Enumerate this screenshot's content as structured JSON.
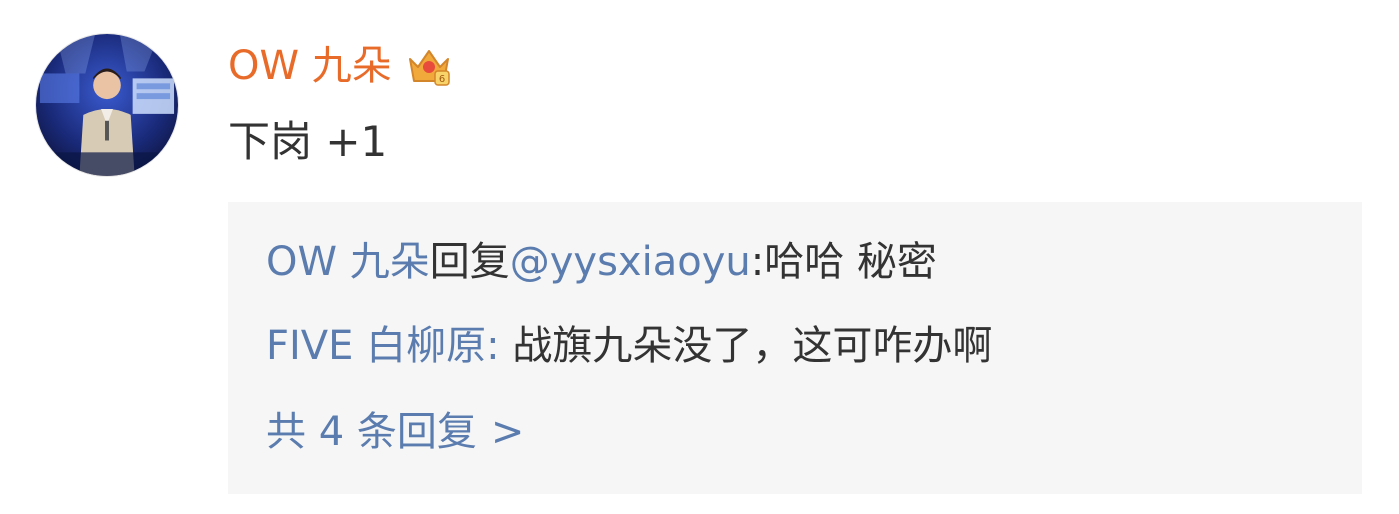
{
  "comment": {
    "username": "OW 九朵",
    "text": "下岗 +1",
    "avatar_icon": "avatar-photo",
    "badge_icon": "vip-crown-icon",
    "username_color": "#e86b2a"
  },
  "replies": [
    {
      "author": "OW 九朵",
      "action": "回复",
      "mention": "@yysxiaoyu",
      "text": ":哈哈 秘密"
    },
    {
      "author": "FIVE 白柳原",
      "separator": ":",
      "text": " 战旗九朵没了，这可咋办啊"
    }
  ],
  "more_replies": {
    "label": "共 4 条回复",
    "chevron": ">"
  },
  "colors": {
    "link_blue": "#5b7cae",
    "reply_bg": "#f6f6f6"
  }
}
